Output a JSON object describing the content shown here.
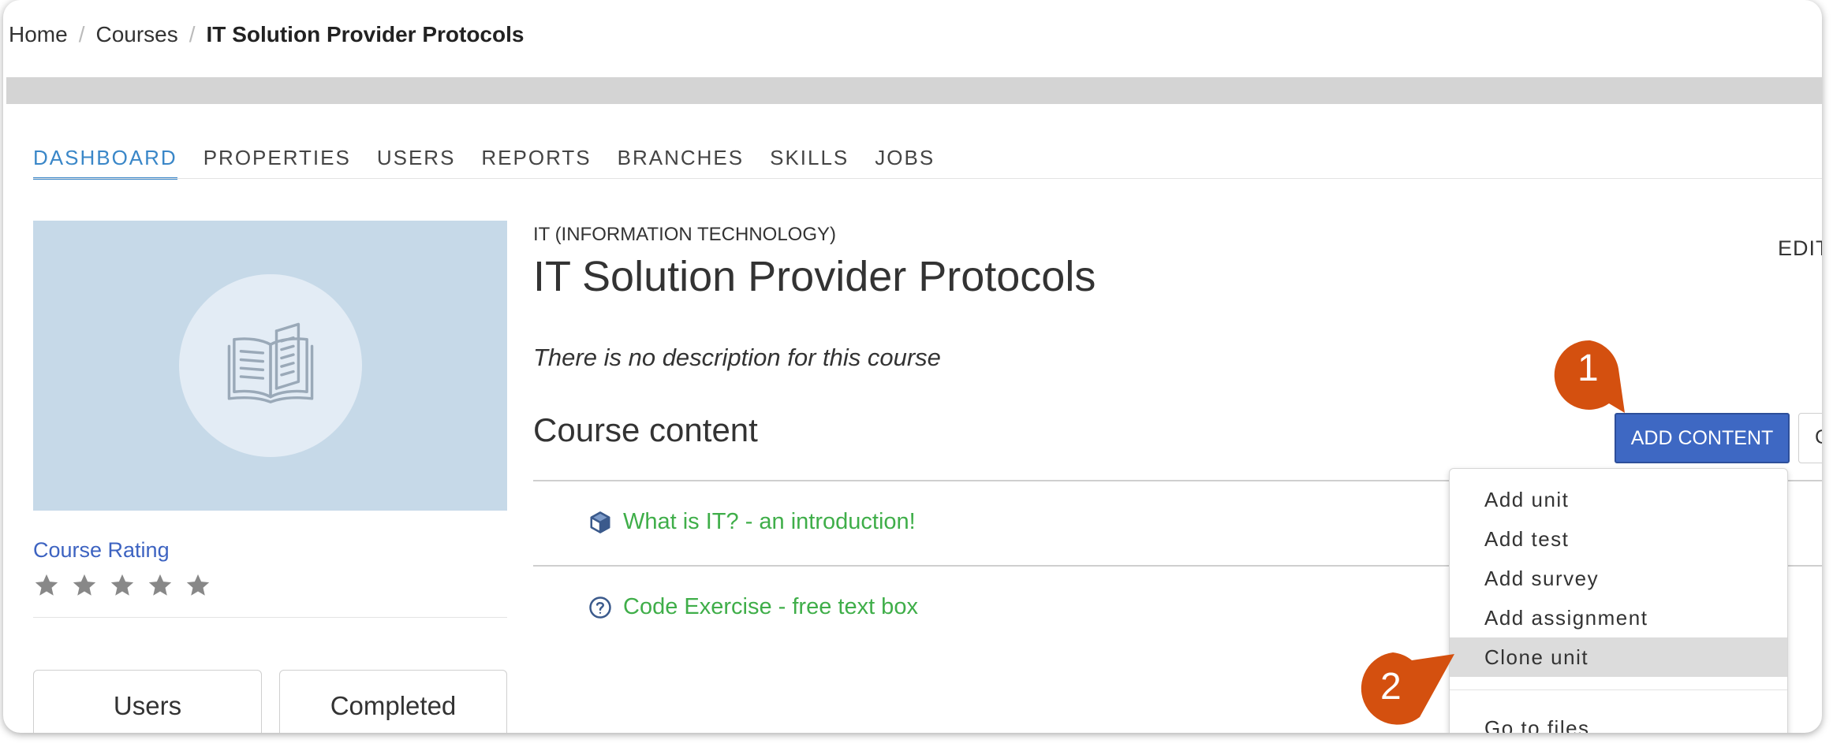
{
  "breadcrumb": {
    "items": [
      "Home",
      "Courses"
    ],
    "current": "IT Solution Provider Protocols",
    "separator": "/"
  },
  "tabs": [
    "DASHBOARD",
    "PROPERTIES",
    "USERS",
    "REPORTS",
    "BRANCHES",
    "SKILLS",
    "JOBS"
  ],
  "active_tab": "DASHBOARD",
  "course": {
    "category": "IT (INFORMATION TECHNOLOGY)",
    "title": "IT Solution Provider Protocols",
    "description": "There is no description for this course",
    "thumbnail_icon": "open-book-icon"
  },
  "edit_label": "EDIT",
  "rating": {
    "label": "Course Rating",
    "stars_total": 5,
    "stars_filled": 0,
    "star_color": "#888888"
  },
  "stats": {
    "users_label": "Users",
    "completed_label": "Completed"
  },
  "content": {
    "heading": "Course content",
    "add_button_label": "ADD CONTENT",
    "second_button_label": "C",
    "units": [
      {
        "title": "What is IT? - an introduction!",
        "icon": "cube-icon"
      },
      {
        "title": "Code Exercise - free text box",
        "icon": "question-circle-icon"
      }
    ]
  },
  "dropdown": {
    "items": [
      "Add unit",
      "Add test",
      "Add survey",
      "Add assignment",
      "Clone unit"
    ],
    "highlighted": "Clone unit",
    "secondary_items": [
      "Go to files"
    ]
  },
  "callouts": [
    "1",
    "2"
  ],
  "colors": {
    "accent_blue": "#3a87c8",
    "button_blue": "#3e68c3",
    "link_green": "#3fae49",
    "callout_orange": "#d4500f",
    "rating_blue": "#3d63c1"
  }
}
